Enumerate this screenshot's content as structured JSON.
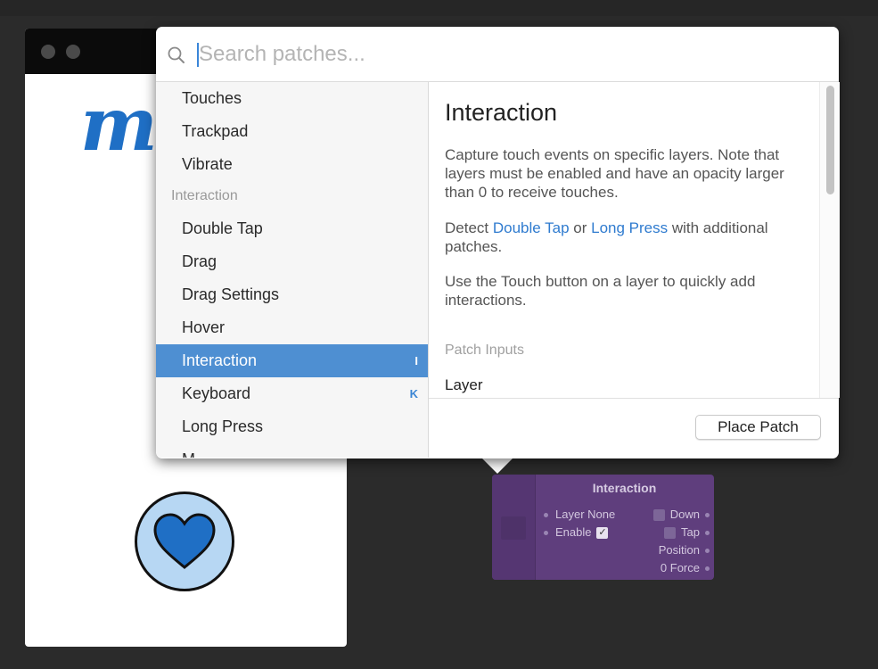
{
  "viewer": {
    "logo_text": "m",
    "heart_color": "#1f6fc5"
  },
  "search": {
    "placeholder": "Search patches...",
    "value": ""
  },
  "patch_list": {
    "items": [
      {
        "label": "Touches",
        "type": "item"
      },
      {
        "label": "Trackpad",
        "type": "item"
      },
      {
        "label": "Vibrate",
        "type": "item"
      },
      {
        "label": "Interaction",
        "type": "section"
      },
      {
        "label": "Double Tap",
        "type": "item"
      },
      {
        "label": "Drag",
        "type": "item"
      },
      {
        "label": "Drag Settings",
        "type": "item"
      },
      {
        "label": "Hover",
        "type": "item"
      },
      {
        "label": "Interaction",
        "type": "item",
        "selected": true,
        "shortcut": "I"
      },
      {
        "label": "Keyboard",
        "type": "item",
        "shortcut": "K"
      },
      {
        "label": "Long Press",
        "type": "item"
      },
      {
        "label": "M...",
        "type": "item"
      }
    ]
  },
  "detail": {
    "title": "Interaction",
    "p1": "Capture touch events on specific layers. Note that layers must be enabled and have an opacity larger than 0 to receive touches.",
    "p2_pre": "Detect ",
    "p2_link1": "Double Tap",
    "p2_mid": " or ",
    "p2_link2": "Long Press",
    "p2_post": " with additional patches.",
    "p3": "Use the Touch button on a layer to quickly add interactions.",
    "inputs_heading": "Patch Inputs",
    "first_input": "Layer",
    "place_button": "Place Patch"
  },
  "node": {
    "title": "Interaction",
    "inputs": [
      {
        "label": "Layer",
        "value": "None"
      },
      {
        "label": "Enable",
        "checked": true
      }
    ],
    "outputs": [
      {
        "label": "Down"
      },
      {
        "label": "Tap"
      },
      {
        "label": "Position"
      },
      {
        "label": "Force",
        "value": "0"
      }
    ],
    "color": "#5f3e7d"
  },
  "colors": {
    "accent": "#4e8fd2",
    "link": "#2f7bcf"
  }
}
